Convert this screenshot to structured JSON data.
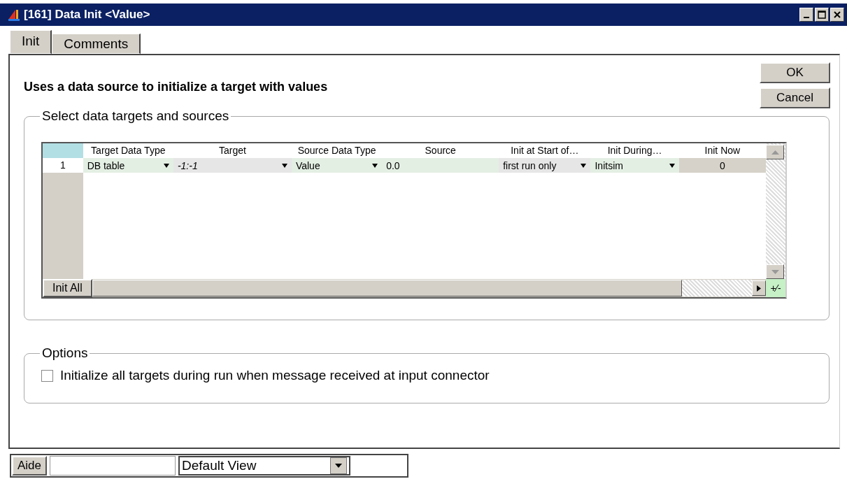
{
  "window": {
    "title": "[161] Data Init <Value>"
  },
  "tabs": [
    {
      "label": "Init",
      "selected": true
    },
    {
      "label": "Comments",
      "selected": false
    }
  ],
  "description": "Uses a data source to initialize a target with values",
  "buttons": [
    {
      "label": "OK"
    },
    {
      "label": "Cancel"
    }
  ],
  "targets_group": {
    "title": "Select data targets and sources",
    "table": {
      "columns": [
        "Target Data Type",
        "Target",
        "Source Data Type",
        "Source",
        "Init at Start of…",
        "Init During…",
        "Init Now"
      ],
      "rows": [
        {
          "number": "1",
          "cells": [
            {
              "kind": "dropdown",
              "value": "DB table"
            },
            {
              "kind": "dropdown",
              "value": "-1:-1",
              "italic": true
            },
            {
              "kind": "dropdown",
              "value": "Value"
            },
            {
              "kind": "text",
              "value": "0.0"
            },
            {
              "kind": "dropdown",
              "value": "first run only"
            },
            {
              "kind": "dropdown",
              "value": "Initsim"
            },
            {
              "kind": "readonly",
              "value": "0"
            }
          ]
        }
      ]
    },
    "init_all_button": "Init All",
    "plus_minus": "+⁄-"
  },
  "options_group": {
    "title": "Options",
    "checkbox": {
      "label": "Initialize all targets during run when message received at input connector",
      "checked": false
    }
  },
  "bottom_bar": {
    "help_button": "Aide",
    "view_select": "Default View"
  }
}
